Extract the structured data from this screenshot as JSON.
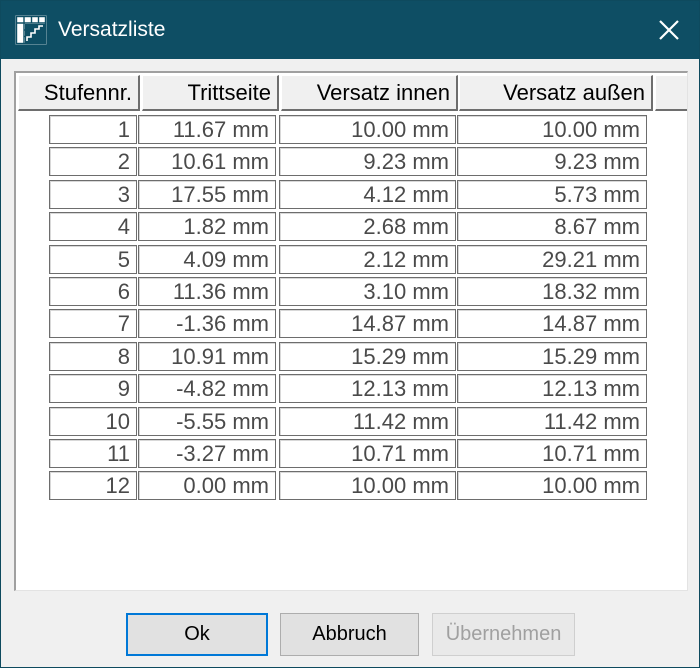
{
  "window": {
    "title": "Versatzliste",
    "title_bar_color": "#0e4e64",
    "icon": "stair-grid-icon",
    "close_icon": "close-icon"
  },
  "table": {
    "columns": [
      "Stufennr.",
      "Trittseite",
      "Versatz innen",
      "Versatz außen"
    ],
    "rows": [
      [
        "1",
        "11.67 mm",
        "10.00 mm",
        "10.00 mm"
      ],
      [
        "2",
        "10.61 mm",
        "9.23 mm",
        "9.23 mm"
      ],
      [
        "3",
        "17.55 mm",
        "4.12 mm",
        "5.73 mm"
      ],
      [
        "4",
        "1.82 mm",
        "2.68 mm",
        "8.67 mm"
      ],
      [
        "5",
        "4.09 mm",
        "2.12 mm",
        "29.21 mm"
      ],
      [
        "6",
        "11.36 mm",
        "3.10 mm",
        "18.32 mm"
      ],
      [
        "7",
        "-1.36 mm",
        "14.87 mm",
        "14.87 mm"
      ],
      [
        "8",
        "10.91 mm",
        "15.29 mm",
        "15.29 mm"
      ],
      [
        "9",
        "-4.82 mm",
        "12.13 mm",
        "12.13 mm"
      ],
      [
        "10",
        "-5.55 mm",
        "11.42 mm",
        "11.42 mm"
      ],
      [
        "11",
        "-3.27 mm",
        "10.71 mm",
        "10.71 mm"
      ],
      [
        "12",
        "0.00 mm",
        "10.00 mm",
        "10.00 mm"
      ]
    ]
  },
  "buttons": {
    "ok": "Ok",
    "cancel": "Abbruch",
    "apply": "Übernehmen",
    "apply_enabled": false
  }
}
